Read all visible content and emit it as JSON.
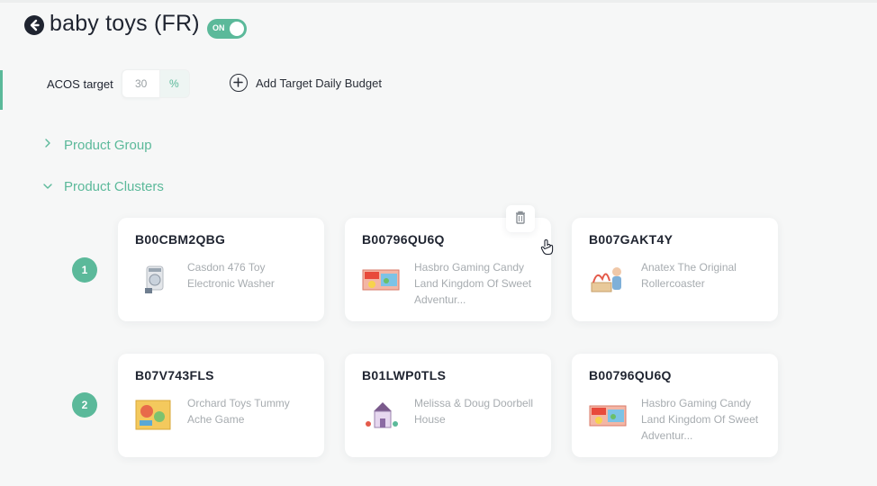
{
  "header": {
    "title": "baby toys (FR)",
    "toggle_label": "ON",
    "accent": "#5bb99a"
  },
  "acos": {
    "label": "ACOS target",
    "value": "30",
    "unit": "%"
  },
  "budget": {
    "add_label": "Add Target Daily Budget"
  },
  "sections": {
    "product_group": "Product Group",
    "product_clusters": "Product Clusters"
  },
  "clusters": [
    {
      "number": "1",
      "cards": [
        {
          "asin": "B00CBM2QBG",
          "name": "Casdon 476 Toy Electronic Washer",
          "thumb": "washer-toy-image"
        },
        {
          "asin": "B00796QU6Q",
          "name": "Hasbro Gaming Candy Land Kingdom Of Sweet Adventur...",
          "thumb": "board-game-box-image"
        },
        {
          "asin": "B007GAKT4Y",
          "name": "Anatex The Original Rollercoaster",
          "thumb": "rollercoaster-toy-image"
        }
      ]
    },
    {
      "number": "2",
      "cards": [
        {
          "asin": "B07V743FLS",
          "name": "Orchard Toys Tummy Ache Game",
          "thumb": "tummy-ache-game-image"
        },
        {
          "asin": "B01LWP0TLS",
          "name": "Melissa & Doug Doorbell House",
          "thumb": "doorbell-house-image"
        },
        {
          "asin": "B00796QU6Q",
          "name": "Hasbro Gaming Candy Land Kingdom Of Sweet Adventur...",
          "thumb": "board-game-box-image"
        }
      ]
    }
  ]
}
